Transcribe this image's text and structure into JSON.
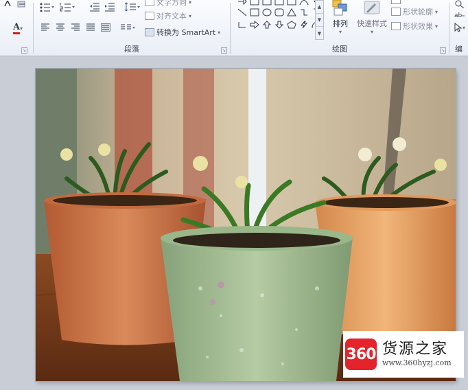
{
  "ribbon": {
    "paragraph": {
      "group_label": "段落",
      "text_direction_label": "文字方向",
      "align_text_label": "对齐文本",
      "convert_smartart_label": "转换为 SmartArt"
    },
    "drawing": {
      "group_label": "绘图",
      "arrange_label": "排列",
      "quick_styles_label": "快速样式",
      "shape_outline_label": "形状轮廓",
      "shape_effects_label": "形状效果"
    },
    "font": {
      "font_color_letter": "A"
    },
    "edit": {
      "group_label_partial": "编"
    }
  },
  "slide": {
    "image_description": "three potted plants"
  },
  "watermark": {
    "badge_text": "360",
    "site_name": "货源之家",
    "url": "www.360hyzj.com",
    "brand_color": "#e4232b"
  },
  "colors": {
    "ribbon_bg": "#f1f4f9",
    "doc_bg": "#c9ced6"
  }
}
